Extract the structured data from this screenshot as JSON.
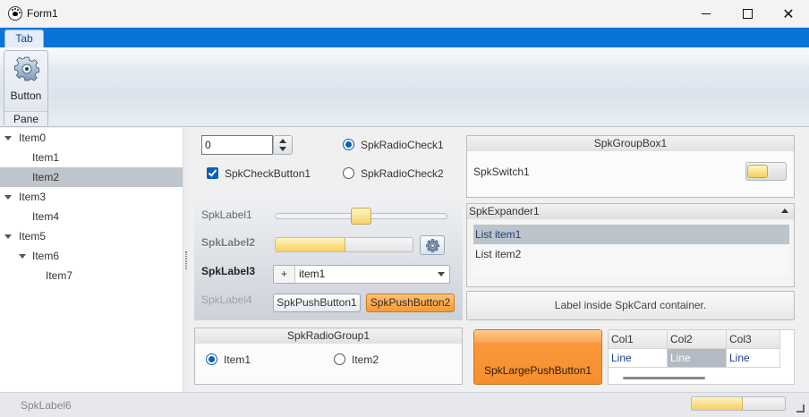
{
  "window": {
    "title": "Form1",
    "minimize_icon": "minimize-icon",
    "maximize_icon": "maximize-icon",
    "close_glyph": "✕"
  },
  "ribbon": {
    "tabs": [
      {
        "label": "Tab"
      }
    ],
    "pane": {
      "caption": "Pane",
      "button_label": "Button",
      "button_icon": "gear-icon"
    },
    "tab_strip_color": "#0a74d6"
  },
  "tree": {
    "nodes": [
      {
        "label": "Item0",
        "expanded": true
      },
      {
        "label": "Item1"
      },
      {
        "label": "Item2",
        "selected": true
      },
      {
        "label": "Item3",
        "expanded": true
      },
      {
        "label": "Item4"
      },
      {
        "label": "Item5",
        "expanded": true
      },
      {
        "label": "Item6",
        "expanded": true
      },
      {
        "label": "Item7"
      }
    ]
  },
  "controls": {
    "spin_value": "0",
    "check_button": {
      "label": "SpkCheckButton1",
      "checked": true
    },
    "radio_check1": {
      "label": "SpkRadioCheck1",
      "checked": true
    },
    "radio_check2": {
      "label": "SpkRadioCheck2",
      "checked": false
    },
    "labels": {
      "l1": "SpkLabel1",
      "l2": "SpkLabel2",
      "l3": "SpkLabel3",
      "l4": "SpkLabel4"
    },
    "trackbar_position": 0.46,
    "progress_fraction": 0.51,
    "combo": {
      "prefix": "+",
      "value": "item1"
    },
    "push1": "SpkPushButton1",
    "push2": "SpkPushButton2"
  },
  "radio_group": {
    "caption": "SpkRadioGroup1",
    "items": [
      {
        "label": "Item1",
        "checked": true
      },
      {
        "label": "Item2",
        "checked": false
      }
    ]
  },
  "group_box": {
    "caption": "SpkGroupBox1",
    "switch_label": "SpkSwitch1",
    "switch_on": false
  },
  "expander": {
    "caption": "SpkExpander1",
    "items": [
      {
        "label": "List item1",
        "selected": true
      },
      {
        "label": "List item2"
      }
    ]
  },
  "card": {
    "text": "Label inside SpkCard container."
  },
  "large_button": {
    "label": "SpkLargePushButton1"
  },
  "grid": {
    "columns": [
      "Col1",
      "Col2",
      "Col3"
    ],
    "rows": [
      [
        "Line",
        "Line",
        "Line"
      ]
    ]
  },
  "status": {
    "label": "SpkLabel6",
    "progress_fraction": 0.55
  },
  "colors": {
    "accent": "#0b5fb8",
    "orange": "#f79b38",
    "yellow": "#f6d05a"
  }
}
